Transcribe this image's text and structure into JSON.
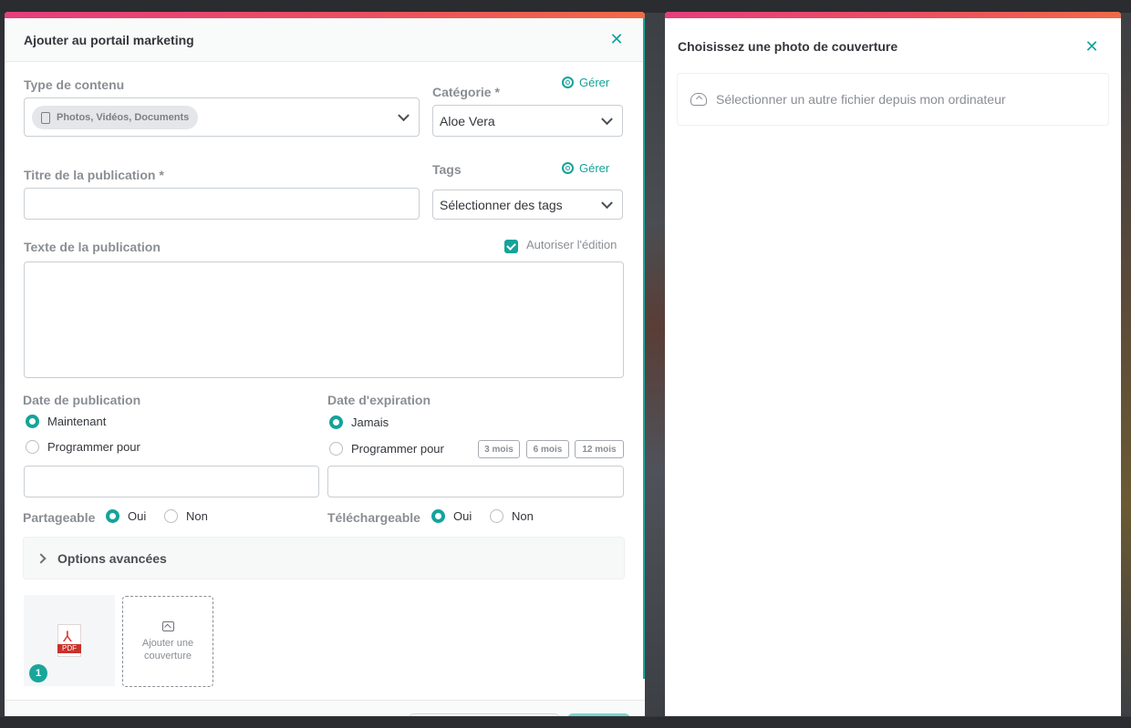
{
  "left_modal": {
    "title": "Ajouter au portail marketing",
    "content_type": {
      "label": "Type de contenu",
      "chip": "Photos, Vidéos, Documents"
    },
    "category": {
      "label": "Catégorie *",
      "manage": "Gérer",
      "value": "Aloe Vera"
    },
    "post_title": {
      "label": "Titre de la publication *",
      "value": ""
    },
    "tags": {
      "label": "Tags",
      "manage": "Gérer",
      "placeholder": "Sélectionner des tags"
    },
    "post_text": {
      "label": "Texte de la publication",
      "allow_edit_label": "Autoriser l'édition",
      "allow_edit_checked": true,
      "value": ""
    },
    "publish_date": {
      "label": "Date de publication",
      "options": [
        "Maintenant",
        "Programmer pour"
      ],
      "selected": "Maintenant"
    },
    "expiry_date": {
      "label": "Date d'expiration",
      "options": [
        "Jamais",
        "Programmer pour"
      ],
      "selected": "Jamais",
      "quick": [
        "3 mois",
        "6 mois",
        "12 mois"
      ]
    },
    "shareable": {
      "label": "Partageable",
      "yes": "Oui",
      "no": "Non",
      "selected": "Oui"
    },
    "downloadable": {
      "label": "Téléchargeable",
      "yes": "Oui",
      "no": "Non",
      "selected": "Oui"
    },
    "advanced": "Options avancées",
    "file": {
      "badge": "1",
      "icon_label": "PDF"
    },
    "add_cover": "Ajouter une couverture"
  },
  "right_modal": {
    "title": "Choisissez une photo de couverture",
    "upload_text": "Sélectionner un autre fichier depuis mon ordinateur"
  },
  "colors": {
    "accent": "#14a39a",
    "topbar_start": "#e53e7d",
    "topbar_end": "#ef6a47"
  }
}
